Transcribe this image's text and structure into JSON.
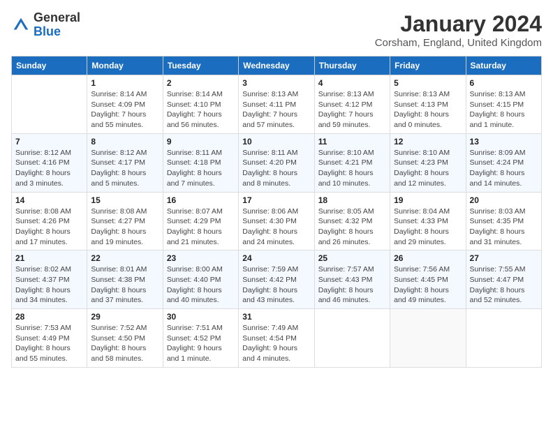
{
  "header": {
    "logo_general": "General",
    "logo_blue": "Blue",
    "month_title": "January 2024",
    "location": "Corsham, England, United Kingdom"
  },
  "days_of_week": [
    "Sunday",
    "Monday",
    "Tuesday",
    "Wednesday",
    "Thursday",
    "Friday",
    "Saturday"
  ],
  "weeks": [
    [
      {
        "day": "",
        "sunrise": "",
        "sunset": "",
        "daylight": ""
      },
      {
        "day": "1",
        "sunrise": "Sunrise: 8:14 AM",
        "sunset": "Sunset: 4:09 PM",
        "daylight": "Daylight: 7 hours and 55 minutes."
      },
      {
        "day": "2",
        "sunrise": "Sunrise: 8:14 AM",
        "sunset": "Sunset: 4:10 PM",
        "daylight": "Daylight: 7 hours and 56 minutes."
      },
      {
        "day": "3",
        "sunrise": "Sunrise: 8:13 AM",
        "sunset": "Sunset: 4:11 PM",
        "daylight": "Daylight: 7 hours and 57 minutes."
      },
      {
        "day": "4",
        "sunrise": "Sunrise: 8:13 AM",
        "sunset": "Sunset: 4:12 PM",
        "daylight": "Daylight: 7 hours and 59 minutes."
      },
      {
        "day": "5",
        "sunrise": "Sunrise: 8:13 AM",
        "sunset": "Sunset: 4:13 PM",
        "daylight": "Daylight: 8 hours and 0 minutes."
      },
      {
        "day": "6",
        "sunrise": "Sunrise: 8:13 AM",
        "sunset": "Sunset: 4:15 PM",
        "daylight": "Daylight: 8 hours and 1 minute."
      }
    ],
    [
      {
        "day": "7",
        "sunrise": "Sunrise: 8:12 AM",
        "sunset": "Sunset: 4:16 PM",
        "daylight": "Daylight: 8 hours and 3 minutes."
      },
      {
        "day": "8",
        "sunrise": "Sunrise: 8:12 AM",
        "sunset": "Sunset: 4:17 PM",
        "daylight": "Daylight: 8 hours and 5 minutes."
      },
      {
        "day": "9",
        "sunrise": "Sunrise: 8:11 AM",
        "sunset": "Sunset: 4:18 PM",
        "daylight": "Daylight: 8 hours and 7 minutes."
      },
      {
        "day": "10",
        "sunrise": "Sunrise: 8:11 AM",
        "sunset": "Sunset: 4:20 PM",
        "daylight": "Daylight: 8 hours and 8 minutes."
      },
      {
        "day": "11",
        "sunrise": "Sunrise: 8:10 AM",
        "sunset": "Sunset: 4:21 PM",
        "daylight": "Daylight: 8 hours and 10 minutes."
      },
      {
        "day": "12",
        "sunrise": "Sunrise: 8:10 AM",
        "sunset": "Sunset: 4:23 PM",
        "daylight": "Daylight: 8 hours and 12 minutes."
      },
      {
        "day": "13",
        "sunrise": "Sunrise: 8:09 AM",
        "sunset": "Sunset: 4:24 PM",
        "daylight": "Daylight: 8 hours and 14 minutes."
      }
    ],
    [
      {
        "day": "14",
        "sunrise": "Sunrise: 8:08 AM",
        "sunset": "Sunset: 4:26 PM",
        "daylight": "Daylight: 8 hours and 17 minutes."
      },
      {
        "day": "15",
        "sunrise": "Sunrise: 8:08 AM",
        "sunset": "Sunset: 4:27 PM",
        "daylight": "Daylight: 8 hours and 19 minutes."
      },
      {
        "day": "16",
        "sunrise": "Sunrise: 8:07 AM",
        "sunset": "Sunset: 4:29 PM",
        "daylight": "Daylight: 8 hours and 21 minutes."
      },
      {
        "day": "17",
        "sunrise": "Sunrise: 8:06 AM",
        "sunset": "Sunset: 4:30 PM",
        "daylight": "Daylight: 8 hours and 24 minutes."
      },
      {
        "day": "18",
        "sunrise": "Sunrise: 8:05 AM",
        "sunset": "Sunset: 4:32 PM",
        "daylight": "Daylight: 8 hours and 26 minutes."
      },
      {
        "day": "19",
        "sunrise": "Sunrise: 8:04 AM",
        "sunset": "Sunset: 4:33 PM",
        "daylight": "Daylight: 8 hours and 29 minutes."
      },
      {
        "day": "20",
        "sunrise": "Sunrise: 8:03 AM",
        "sunset": "Sunset: 4:35 PM",
        "daylight": "Daylight: 8 hours and 31 minutes."
      }
    ],
    [
      {
        "day": "21",
        "sunrise": "Sunrise: 8:02 AM",
        "sunset": "Sunset: 4:37 PM",
        "daylight": "Daylight: 8 hours and 34 minutes."
      },
      {
        "day": "22",
        "sunrise": "Sunrise: 8:01 AM",
        "sunset": "Sunset: 4:38 PM",
        "daylight": "Daylight: 8 hours and 37 minutes."
      },
      {
        "day": "23",
        "sunrise": "Sunrise: 8:00 AM",
        "sunset": "Sunset: 4:40 PM",
        "daylight": "Daylight: 8 hours and 40 minutes."
      },
      {
        "day": "24",
        "sunrise": "Sunrise: 7:59 AM",
        "sunset": "Sunset: 4:42 PM",
        "daylight": "Daylight: 8 hours and 43 minutes."
      },
      {
        "day": "25",
        "sunrise": "Sunrise: 7:57 AM",
        "sunset": "Sunset: 4:43 PM",
        "daylight": "Daylight: 8 hours and 46 minutes."
      },
      {
        "day": "26",
        "sunrise": "Sunrise: 7:56 AM",
        "sunset": "Sunset: 4:45 PM",
        "daylight": "Daylight: 8 hours and 49 minutes."
      },
      {
        "day": "27",
        "sunrise": "Sunrise: 7:55 AM",
        "sunset": "Sunset: 4:47 PM",
        "daylight": "Daylight: 8 hours and 52 minutes."
      }
    ],
    [
      {
        "day": "28",
        "sunrise": "Sunrise: 7:53 AM",
        "sunset": "Sunset: 4:49 PM",
        "daylight": "Daylight: 8 hours and 55 minutes."
      },
      {
        "day": "29",
        "sunrise": "Sunrise: 7:52 AM",
        "sunset": "Sunset: 4:50 PM",
        "daylight": "Daylight: 8 hours and 58 minutes."
      },
      {
        "day": "30",
        "sunrise": "Sunrise: 7:51 AM",
        "sunset": "Sunset: 4:52 PM",
        "daylight": "Daylight: 9 hours and 1 minute."
      },
      {
        "day": "31",
        "sunrise": "Sunrise: 7:49 AM",
        "sunset": "Sunset: 4:54 PM",
        "daylight": "Daylight: 9 hours and 4 minutes."
      },
      {
        "day": "",
        "sunrise": "",
        "sunset": "",
        "daylight": ""
      },
      {
        "day": "",
        "sunrise": "",
        "sunset": "",
        "daylight": ""
      },
      {
        "day": "",
        "sunrise": "",
        "sunset": "",
        "daylight": ""
      }
    ]
  ]
}
